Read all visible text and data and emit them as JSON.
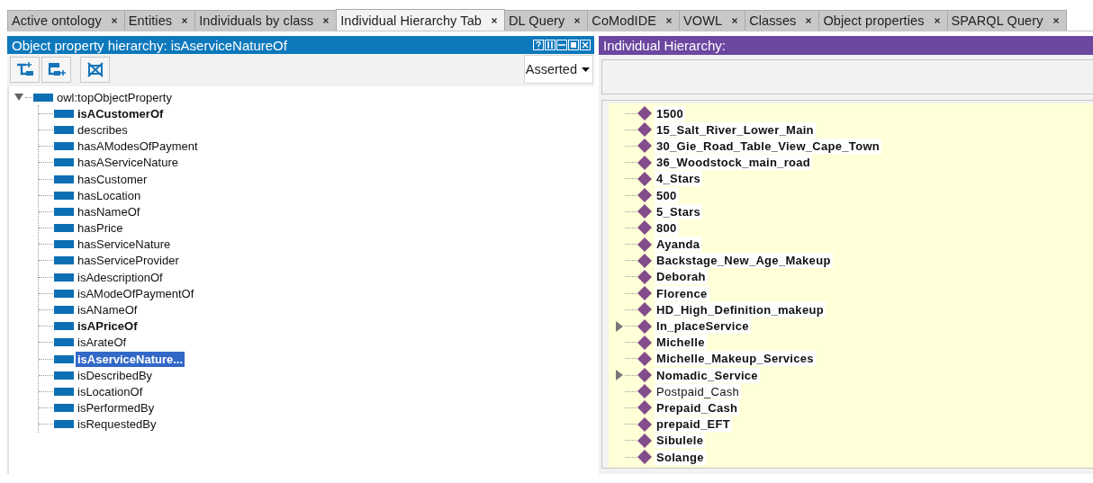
{
  "tabs": [
    {
      "label": "Active ontology",
      "selected": false
    },
    {
      "label": "Entities",
      "selected": false
    },
    {
      "label": "Individuals by class",
      "selected": false
    },
    {
      "label": "Individual Hierarchy Tab",
      "selected": true
    },
    {
      "label": "DL Query",
      "selected": false
    },
    {
      "label": "CoModIDE",
      "selected": false
    },
    {
      "label": "VOWL",
      "selected": false
    },
    {
      "label": "Classes",
      "selected": false
    },
    {
      "label": "Object properties",
      "selected": false
    },
    {
      "label": "SPARQL Query",
      "selected": false
    }
  ],
  "property_panel": {
    "title": "Object property hierarchy: isAserviceNatureOf",
    "view_mode": "Asserted",
    "tree": {
      "label": "owl:topObjectProperty",
      "expanded": true,
      "children": [
        {
          "label": "isACustomerOf",
          "bold": true,
          "selected": false
        },
        {
          "label": "describes",
          "bold": false,
          "selected": false
        },
        {
          "label": "hasAModesOfPayment",
          "bold": false,
          "selected": false
        },
        {
          "label": "hasAServiceNature",
          "bold": false,
          "selected": false
        },
        {
          "label": "hasCustomer",
          "bold": false,
          "selected": false
        },
        {
          "label": "hasLocation",
          "bold": false,
          "selected": false
        },
        {
          "label": "hasNameOf",
          "bold": false,
          "selected": false
        },
        {
          "label": "hasPrice",
          "bold": false,
          "selected": false
        },
        {
          "label": "hasServiceNature",
          "bold": false,
          "selected": false
        },
        {
          "label": "hasServiceProvider",
          "bold": false,
          "selected": false
        },
        {
          "label": "isAdescriptionOf",
          "bold": false,
          "selected": false
        },
        {
          "label": "isAModeOfPaymentOf",
          "bold": false,
          "selected": false
        },
        {
          "label": "isANameOf",
          "bold": false,
          "selected": false
        },
        {
          "label": "isAPriceOf",
          "bold": true,
          "selected": false
        },
        {
          "label": "isArateOf",
          "bold": false,
          "selected": false
        },
        {
          "label": "isAserviceNature...",
          "bold": true,
          "selected": true
        },
        {
          "label": "isDescribedBy",
          "bold": false,
          "selected": false
        },
        {
          "label": "isLocationOf",
          "bold": false,
          "selected": false
        },
        {
          "label": "isPerformedBy",
          "bold": false,
          "selected": false
        },
        {
          "label": "isRequestedBy",
          "bold": false,
          "selected": false
        }
      ]
    }
  },
  "individual_panel": {
    "title": "Individual Hierarchy:",
    "individuals": [
      {
        "label": "1500",
        "bold": true,
        "expandable": false
      },
      {
        "label": "15_Salt_River_Lower_Main",
        "bold": true,
        "expandable": false
      },
      {
        "label": "30_Gie_Road_Table_View_Cape_Town",
        "bold": true,
        "expandable": false
      },
      {
        "label": "36_Woodstock_main_road",
        "bold": true,
        "expandable": false
      },
      {
        "label": "4_Stars",
        "bold": true,
        "expandable": false
      },
      {
        "label": "500",
        "bold": true,
        "expandable": false
      },
      {
        "label": "5_Stars",
        "bold": true,
        "expandable": false
      },
      {
        "label": "800",
        "bold": true,
        "expandable": false
      },
      {
        "label": "Ayanda",
        "bold": true,
        "expandable": false
      },
      {
        "label": "Backstage_New_Age_Makeup",
        "bold": true,
        "expandable": false
      },
      {
        "label": "Deborah",
        "bold": true,
        "expandable": false
      },
      {
        "label": "Florence",
        "bold": true,
        "expandable": false
      },
      {
        "label": "HD_High_Definition_makeup",
        "bold": true,
        "expandable": false
      },
      {
        "label": "In_placeService",
        "bold": true,
        "expandable": true
      },
      {
        "label": "Michelle",
        "bold": true,
        "expandable": false
      },
      {
        "label": "Michelle_Makeup_Services",
        "bold": true,
        "expandable": false
      },
      {
        "label": "Nomadic_Service",
        "bold": true,
        "expandable": true
      },
      {
        "label": "Postpaid_Cash",
        "bold": false,
        "expandable": false
      },
      {
        "label": "Prepaid_Cash",
        "bold": true,
        "expandable": false
      },
      {
        "label": "prepaid_EFT",
        "bold": true,
        "expandable": false
      },
      {
        "label": "Sibulele",
        "bold": true,
        "expandable": false
      },
      {
        "label": "Solange",
        "bold": true,
        "expandable": false
      }
    ]
  }
}
